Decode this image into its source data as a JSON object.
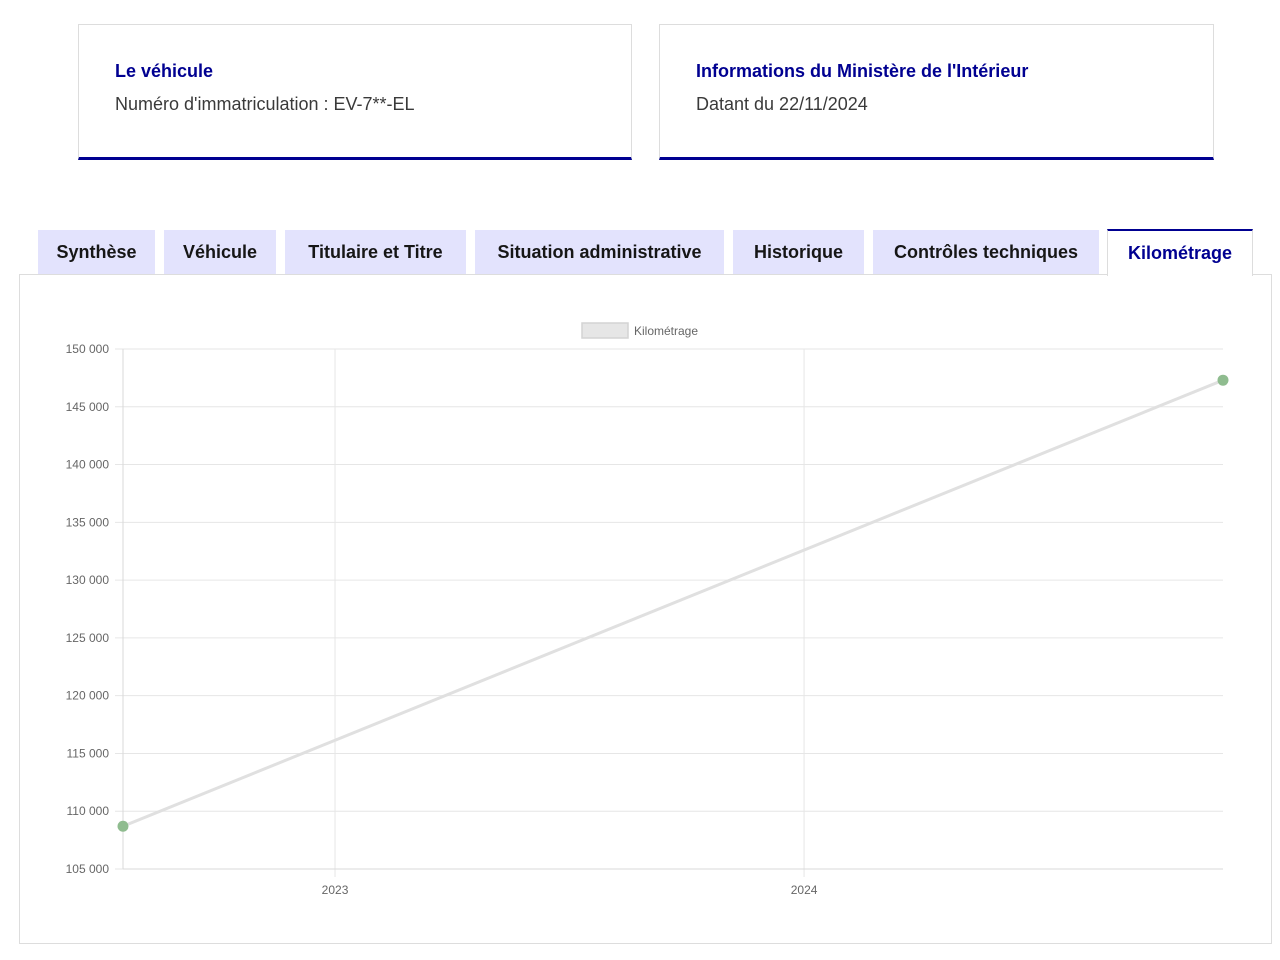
{
  "vehicle_card": {
    "title": "Le véhicule",
    "text": "Numéro d'immatriculation : EV-7**-EL"
  },
  "ministry_card": {
    "title": "Informations du Ministère de l'Intérieur",
    "text": "Datant du 22/11/2024"
  },
  "tabs": [
    {
      "label": "Synthèse",
      "active": false
    },
    {
      "label": "Véhicule",
      "active": false
    },
    {
      "label": "Titulaire et Titre",
      "active": false
    },
    {
      "label": "Situation administrative",
      "active": false
    },
    {
      "label": "Historique",
      "active": false
    },
    {
      "label": "Contrôles techniques",
      "active": false
    },
    {
      "label": "Kilométrage",
      "active": true
    }
  ],
  "colors": {
    "accent": "#000091",
    "tab_bg": "#e3e3fd",
    "line": "#e0e0e0",
    "point": "#8fbc8f"
  },
  "chart_data": {
    "type": "line",
    "legend": {
      "label": "Kilométrage",
      "position": "top"
    },
    "y_ticks": [
      "105 000",
      "110 000",
      "115 000",
      "120 000",
      "125 000",
      "130 000",
      "135 000",
      "140 000",
      "145 000",
      "150 000"
    ],
    "ylim": [
      105000,
      150000
    ],
    "x_ticks": [
      {
        "label": "2023",
        "date": "2023-01-01"
      },
      {
        "label": "2024",
        "date": "2024-01-01"
      }
    ],
    "xlim": [
      "2022-07-20",
      "2024-11-22"
    ],
    "grid": true,
    "series": [
      {
        "name": "Kilométrage",
        "points": [
          {
            "x": "2022-07-20",
            "y": 108700
          },
          {
            "x": "2024-11-22",
            "y": 147300
          }
        ]
      }
    ]
  }
}
